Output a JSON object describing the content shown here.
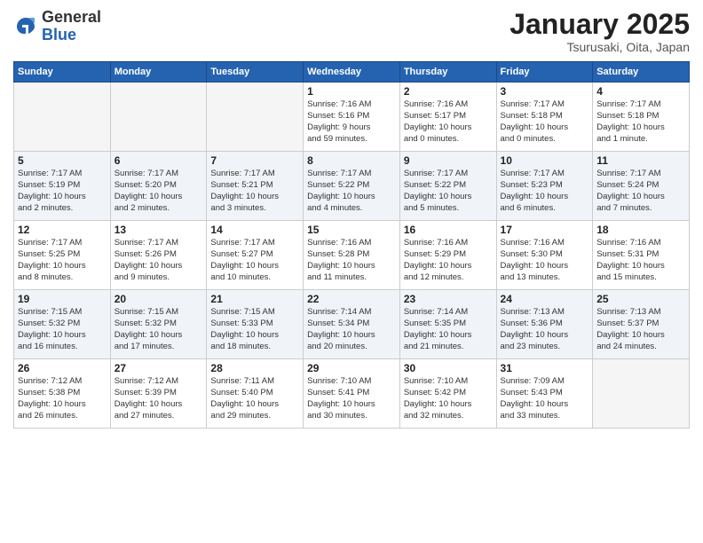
{
  "header": {
    "logo_general": "General",
    "logo_blue": "Blue",
    "month_title": "January 2025",
    "location": "Tsurusaki, Oita, Japan"
  },
  "weekdays": [
    "Sunday",
    "Monday",
    "Tuesday",
    "Wednesday",
    "Thursday",
    "Friday",
    "Saturday"
  ],
  "weeks": [
    [
      {
        "day": "",
        "detail": ""
      },
      {
        "day": "",
        "detail": ""
      },
      {
        "day": "",
        "detail": ""
      },
      {
        "day": "1",
        "detail": "Sunrise: 7:16 AM\nSunset: 5:16 PM\nDaylight: 9 hours\nand 59 minutes."
      },
      {
        "day": "2",
        "detail": "Sunrise: 7:16 AM\nSunset: 5:17 PM\nDaylight: 10 hours\nand 0 minutes."
      },
      {
        "day": "3",
        "detail": "Sunrise: 7:17 AM\nSunset: 5:18 PM\nDaylight: 10 hours\nand 0 minutes."
      },
      {
        "day": "4",
        "detail": "Sunrise: 7:17 AM\nSunset: 5:18 PM\nDaylight: 10 hours\nand 1 minute."
      }
    ],
    [
      {
        "day": "5",
        "detail": "Sunrise: 7:17 AM\nSunset: 5:19 PM\nDaylight: 10 hours\nand 2 minutes."
      },
      {
        "day": "6",
        "detail": "Sunrise: 7:17 AM\nSunset: 5:20 PM\nDaylight: 10 hours\nand 2 minutes."
      },
      {
        "day": "7",
        "detail": "Sunrise: 7:17 AM\nSunset: 5:21 PM\nDaylight: 10 hours\nand 3 minutes."
      },
      {
        "day": "8",
        "detail": "Sunrise: 7:17 AM\nSunset: 5:22 PM\nDaylight: 10 hours\nand 4 minutes."
      },
      {
        "day": "9",
        "detail": "Sunrise: 7:17 AM\nSunset: 5:22 PM\nDaylight: 10 hours\nand 5 minutes."
      },
      {
        "day": "10",
        "detail": "Sunrise: 7:17 AM\nSunset: 5:23 PM\nDaylight: 10 hours\nand 6 minutes."
      },
      {
        "day": "11",
        "detail": "Sunrise: 7:17 AM\nSunset: 5:24 PM\nDaylight: 10 hours\nand 7 minutes."
      }
    ],
    [
      {
        "day": "12",
        "detail": "Sunrise: 7:17 AM\nSunset: 5:25 PM\nDaylight: 10 hours\nand 8 minutes."
      },
      {
        "day": "13",
        "detail": "Sunrise: 7:17 AM\nSunset: 5:26 PM\nDaylight: 10 hours\nand 9 minutes."
      },
      {
        "day": "14",
        "detail": "Sunrise: 7:17 AM\nSunset: 5:27 PM\nDaylight: 10 hours\nand 10 minutes."
      },
      {
        "day": "15",
        "detail": "Sunrise: 7:16 AM\nSunset: 5:28 PM\nDaylight: 10 hours\nand 11 minutes."
      },
      {
        "day": "16",
        "detail": "Sunrise: 7:16 AM\nSunset: 5:29 PM\nDaylight: 10 hours\nand 12 minutes."
      },
      {
        "day": "17",
        "detail": "Sunrise: 7:16 AM\nSunset: 5:30 PM\nDaylight: 10 hours\nand 13 minutes."
      },
      {
        "day": "18",
        "detail": "Sunrise: 7:16 AM\nSunset: 5:31 PM\nDaylight: 10 hours\nand 15 minutes."
      }
    ],
    [
      {
        "day": "19",
        "detail": "Sunrise: 7:15 AM\nSunset: 5:32 PM\nDaylight: 10 hours\nand 16 minutes."
      },
      {
        "day": "20",
        "detail": "Sunrise: 7:15 AM\nSunset: 5:32 PM\nDaylight: 10 hours\nand 17 minutes."
      },
      {
        "day": "21",
        "detail": "Sunrise: 7:15 AM\nSunset: 5:33 PM\nDaylight: 10 hours\nand 18 minutes."
      },
      {
        "day": "22",
        "detail": "Sunrise: 7:14 AM\nSunset: 5:34 PM\nDaylight: 10 hours\nand 20 minutes."
      },
      {
        "day": "23",
        "detail": "Sunrise: 7:14 AM\nSunset: 5:35 PM\nDaylight: 10 hours\nand 21 minutes."
      },
      {
        "day": "24",
        "detail": "Sunrise: 7:13 AM\nSunset: 5:36 PM\nDaylight: 10 hours\nand 23 minutes."
      },
      {
        "day": "25",
        "detail": "Sunrise: 7:13 AM\nSunset: 5:37 PM\nDaylight: 10 hours\nand 24 minutes."
      }
    ],
    [
      {
        "day": "26",
        "detail": "Sunrise: 7:12 AM\nSunset: 5:38 PM\nDaylight: 10 hours\nand 26 minutes."
      },
      {
        "day": "27",
        "detail": "Sunrise: 7:12 AM\nSunset: 5:39 PM\nDaylight: 10 hours\nand 27 minutes."
      },
      {
        "day": "28",
        "detail": "Sunrise: 7:11 AM\nSunset: 5:40 PM\nDaylight: 10 hours\nand 29 minutes."
      },
      {
        "day": "29",
        "detail": "Sunrise: 7:10 AM\nSunset: 5:41 PM\nDaylight: 10 hours\nand 30 minutes."
      },
      {
        "day": "30",
        "detail": "Sunrise: 7:10 AM\nSunset: 5:42 PM\nDaylight: 10 hours\nand 32 minutes."
      },
      {
        "day": "31",
        "detail": "Sunrise: 7:09 AM\nSunset: 5:43 PM\nDaylight: 10 hours\nand 33 minutes."
      },
      {
        "day": "",
        "detail": ""
      }
    ]
  ]
}
